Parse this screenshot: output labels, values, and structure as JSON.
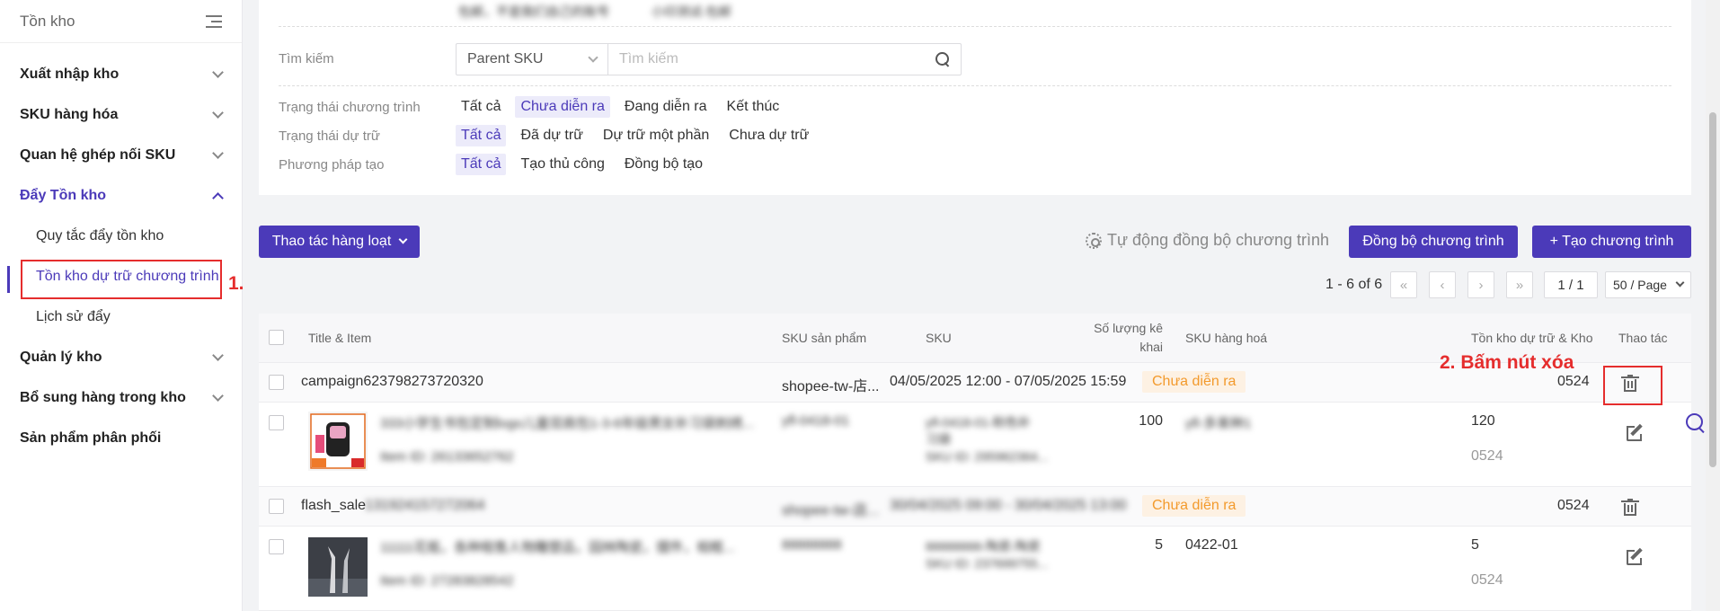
{
  "sidebar": {
    "title": "Tồn kho",
    "items": [
      {
        "label": "Xuất nhập kho"
      },
      {
        "label": "SKU hàng hóa"
      },
      {
        "label": "Quan hệ ghép nối SKU"
      },
      {
        "label": "Đẩy Tồn kho"
      },
      {
        "label": "Quản lý kho"
      },
      {
        "label": "Bổ sung hàng trong kho"
      },
      {
        "label": "Sản phẩm phân phối"
      }
    ],
    "subitems": [
      {
        "label": "Quy tắc đẩy tồn kho"
      },
      {
        "label": "Tồn kho dự trữ chương trình"
      },
      {
        "label": "Lịch sử đẩy"
      }
    ]
  },
  "annotations": {
    "step1": "1.",
    "step2": "2. Bấm nút xóa"
  },
  "filters": {
    "blurred_top_1": "包邮，不是我们自己的账号",
    "blurred_top_2": "小印测试-包邮",
    "search_label": "Tìm kiếm",
    "search_type": "Parent SKU",
    "search_placeholder": "Tìm kiếm",
    "program_status_label": "Trạng thái chương trình",
    "program_status_options": [
      "Tất cả",
      "Chưa diễn ra",
      "Đang diễn ra",
      "Kết thúc"
    ],
    "reserve_status_label": "Trạng thái dự trữ",
    "reserve_status_options": [
      "Tất cả",
      "Đã dự trữ",
      "Dự trữ một phần",
      "Chưa dự trữ"
    ],
    "create_method_label": "Phương pháp tạo",
    "create_method_options": [
      "Tất cả",
      "Tạo thủ công",
      "Đồng bộ tạo"
    ]
  },
  "toolbar": {
    "batch_label": "Thao tác hàng loạt",
    "auto_sync_label": "Tự động đồng bộ chương trình",
    "sync_label": "Đồng bộ chương trình",
    "create_label": "+ Tạo chương trình"
  },
  "pagination": {
    "range": "1 - 6 of 6",
    "first": "«",
    "prev": "‹",
    "next": "›",
    "last": "»",
    "page": "1 / 1",
    "page_size": "50 / Page"
  },
  "table": {
    "headers": {
      "title_item": "Title & Item",
      "product_sku": "SKU sản phẩm",
      "sku": "SKU",
      "qty_line1": "Số lượng kê",
      "qty_line2": "khai",
      "goods_sku": "SKU hàng hoá",
      "reserve_store": "Tồn kho dự trữ & Kho",
      "actions": "Thao tác"
    },
    "groups": [
      {
        "name": "campaign623798273720320",
        "shop": "shopee-tw-店...",
        "period": "04/05/2025 12:00 - 07/05/2025 15:59",
        "status": "Chưa diễn ra",
        "store": "0524",
        "item": {
          "title": "333小学生书包定制logo儿童双肩包1-3-6年级男女补习袋刺绣...",
          "item_id": "Item ID: 26133652762",
          "product_sku": "yfl-0418-01",
          "sku_line1": "yfl-0418-01-粉色补",
          "sku_line2": "习袋",
          "sku_id": "SKU ID: 295962364...",
          "qty": "100",
          "goods_sku": "yfl-多束种1",
          "reserve": "120",
          "store": "0524"
        }
      },
      {
        "name_visible": "flash_sale",
        "name_blurred": "131924157272064",
        "shop": "shopee-tw-店...",
        "period": "30/04/2025 09:00 - 30/04/2025 13:00",
        "status": "Chưa diễn ra",
        "store": "0524",
        "item": {
          "title": "11111花瓶，各种租售人物雕塑品，园林陶瓷，摆件，相框...",
          "item_id": "Item ID: 27283828542",
          "product_sku": "88888888",
          "sku_line1": "88888888-陶瓷-陶瓷",
          "sku_id": "SKU ID: 237699755...",
          "qty": "5",
          "goods_sku": "0422-01",
          "reserve": "5",
          "store": "0524"
        }
      }
    ]
  },
  "colors": {
    "accent": "#4b3ab9",
    "annotation": "#e52d2d",
    "badge_bg": "#fdf1e3",
    "badge_text": "#f39a2c"
  }
}
